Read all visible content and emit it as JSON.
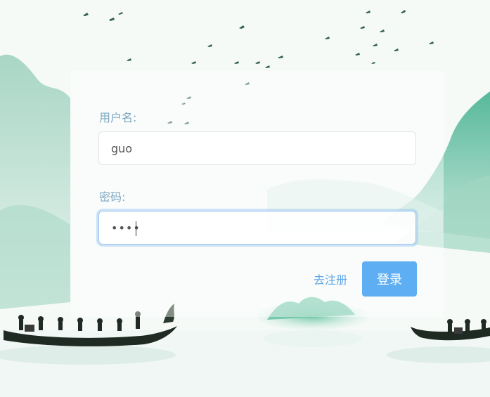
{
  "form": {
    "username_label": "用户名:",
    "username_value": "guo",
    "password_label": "密码:",
    "password_value": "••••"
  },
  "actions": {
    "register_link": "去注册",
    "login_button": "登录"
  },
  "colors": {
    "accent": "#5daef2",
    "link": "#5fa7e8",
    "label": "#7ea8c4",
    "focus_ring": "#9cc6ee"
  },
  "background": {
    "theme": "chinese-ink-landscape-dragon-boats"
  }
}
